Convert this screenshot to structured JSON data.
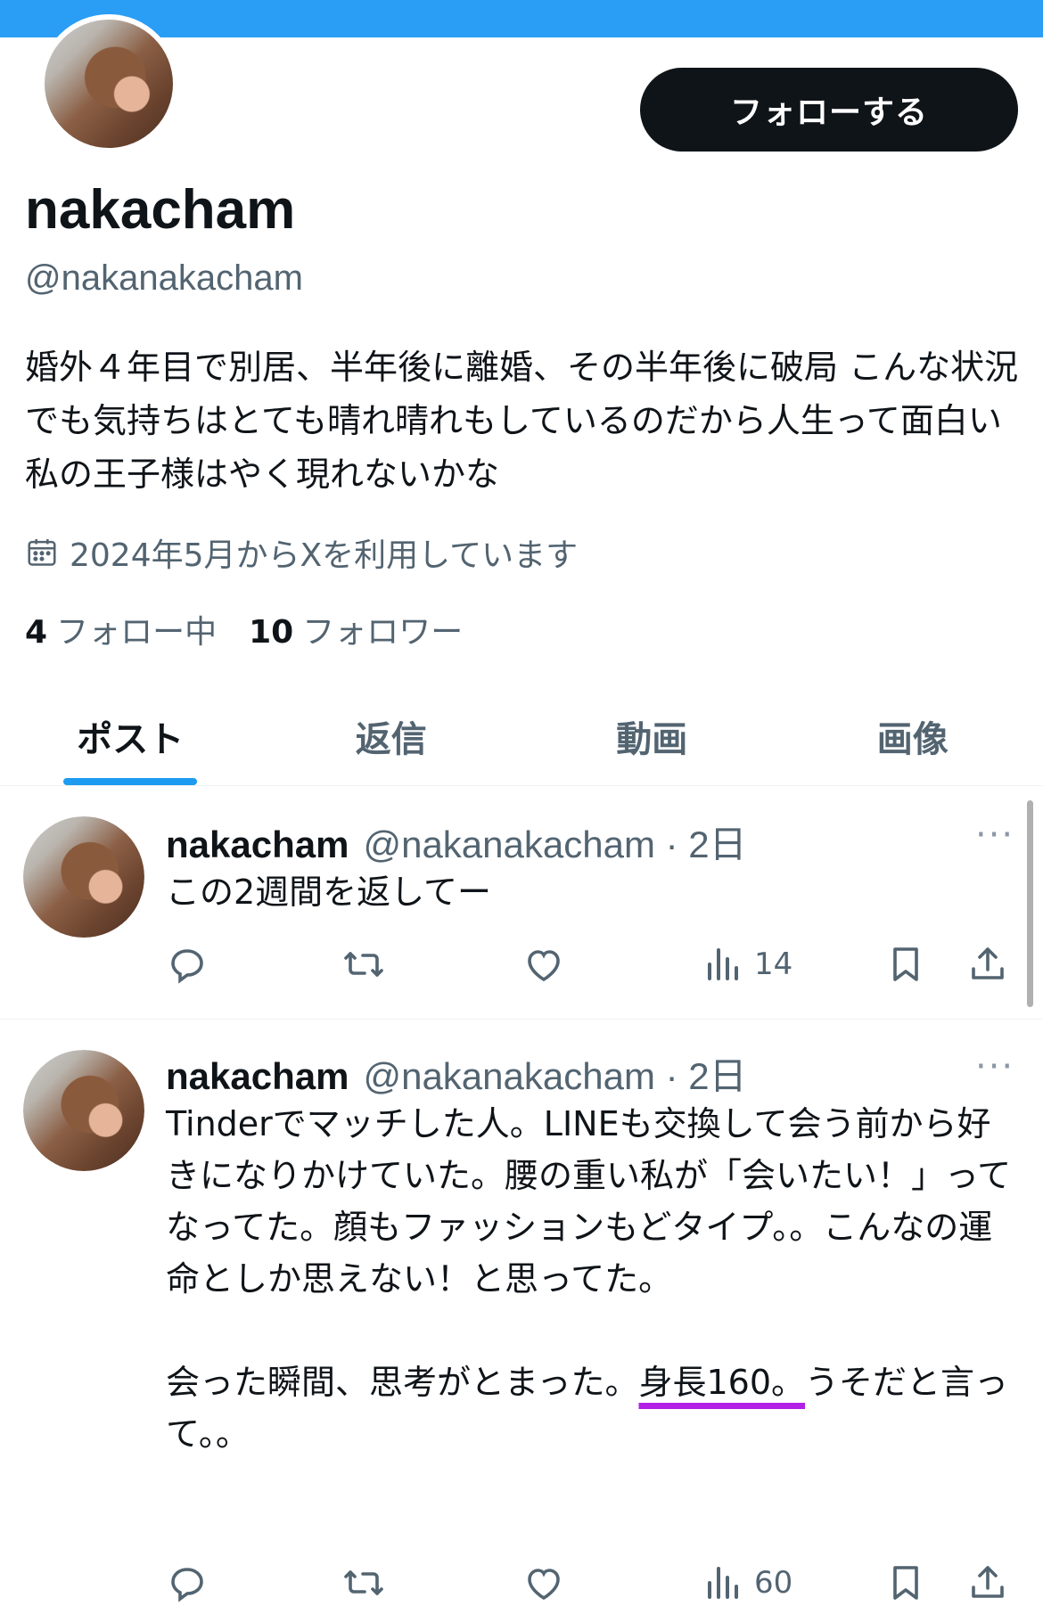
{
  "profile": {
    "display_name": "nakacham",
    "handle": "@nakanakacham",
    "follow_label": "フォローする",
    "bio": "婚外４年目で別居、半年後に離婚、その半年後に破局 こんな状況でも気持ちはとても晴れ晴れもしているのだから人生って面白い 私の王子様はやく現れないかな",
    "joined": "2024年5月からXを利用しています",
    "following_count": "4",
    "following_label": "フォロー中",
    "followers_count": "10",
    "followers_label": "フォロワー"
  },
  "tabs": [
    {
      "label": "ポスト",
      "active": true
    },
    {
      "label": "返信",
      "active": false
    },
    {
      "label": "動画",
      "active": false
    },
    {
      "label": "画像",
      "active": false
    }
  ],
  "tweets": [
    {
      "name": "nakacham",
      "handle": "@nakanakacham",
      "time": "2日",
      "more": "···",
      "text": "この2週間を返してー",
      "views": "14"
    },
    {
      "name": "nakacham",
      "handle": "@nakanakacham",
      "time": "2日",
      "more": "···",
      "text_lines": [
        "Tinderでマッチした人。LINEも交換して会う前から好きになりかけていた。腰の重い私が「会いたい！」ってなってた。顔もファッションもどタイプ。。こんなの運命としか思えない！と思ってた。",
        "",
        "会った瞬間、思考がとまった。"
      ],
      "highlight": "身長160。",
      "text_after": "うそだと言って。。",
      "views": "60"
    }
  ],
  "colors": {
    "banner": "#2a9df4",
    "accent": "#1d9bf0",
    "highlight_underline": "#b220e8",
    "follow_button": "#0f1419"
  }
}
